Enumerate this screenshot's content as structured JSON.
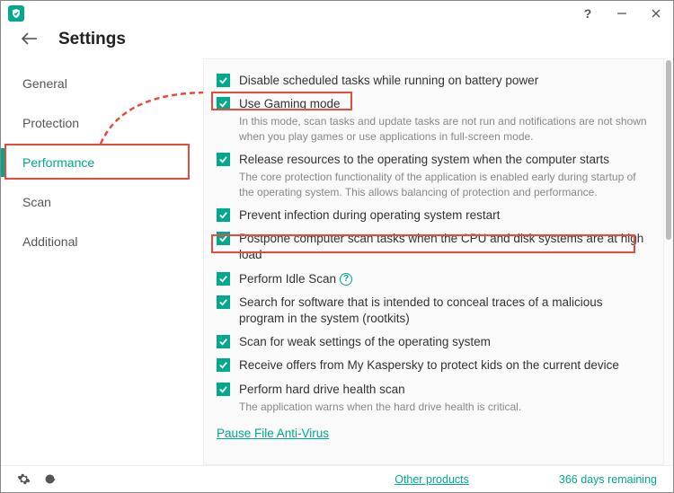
{
  "titlebar": {
    "help_tooltip": "?"
  },
  "header": {
    "title": "Settings"
  },
  "sidebar": {
    "items": [
      {
        "label": "General"
      },
      {
        "label": "Protection"
      },
      {
        "label": "Performance"
      },
      {
        "label": "Scan"
      },
      {
        "label": "Additional"
      }
    ],
    "active_index": 2
  },
  "options": {
    "battery": {
      "label": "Disable scheduled tasks while running on battery power"
    },
    "gaming": {
      "label": "Use Gaming mode",
      "desc": "In this mode, scan tasks and update tasks are not run and notifications are not shown when you play games or use applications in full-screen mode."
    },
    "release": {
      "label": "Release resources to the operating system when the computer starts",
      "desc": "The core protection functionality of the application is enabled early during startup of the operating system. This allows balancing of protection and performance."
    },
    "prevent": {
      "label": "Prevent infection during operating system restart"
    },
    "postpone": {
      "label": "Postpone computer scan tasks when the CPU and disk systems are at high load"
    },
    "idle": {
      "label": "Perform Idle Scan"
    },
    "rootkits": {
      "label": "Search for software that is intended to conceal traces of a malicious program in the system (rootkits)"
    },
    "weak": {
      "label": "Scan for weak settings of the operating system"
    },
    "offers": {
      "label": "Receive offers from My Kaspersky to protect kids on the current device"
    },
    "hdd": {
      "label": "Perform hard drive health scan",
      "desc": "The application warns when the hard drive health is critical."
    }
  },
  "link": {
    "pause_av": "Pause File Anti-Virus"
  },
  "statusbar": {
    "other_products": "Other products",
    "license": "366 days remaining"
  }
}
